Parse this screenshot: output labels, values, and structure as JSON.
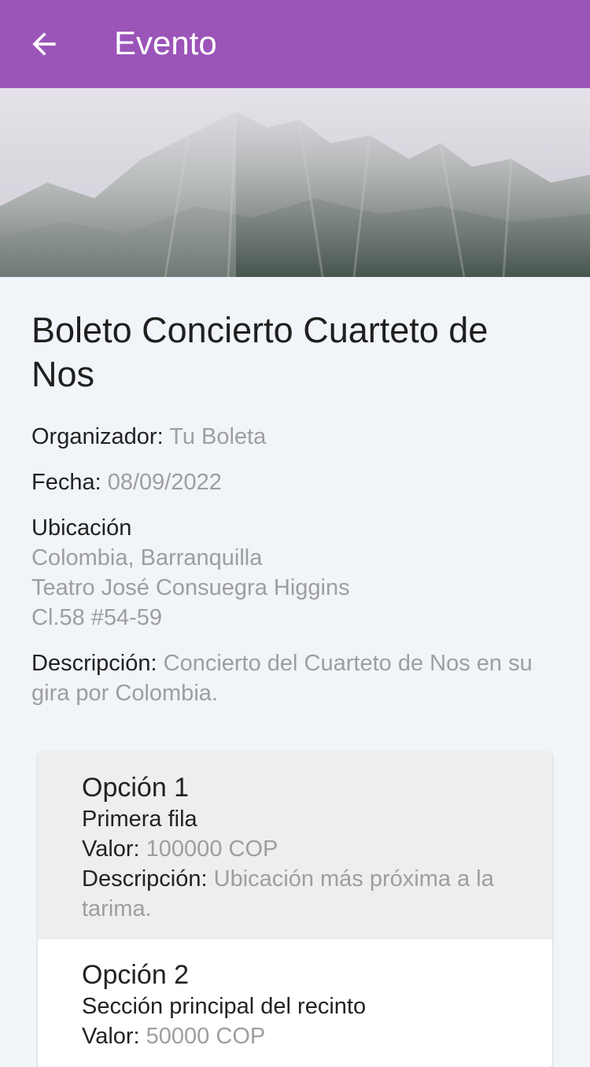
{
  "appbar": {
    "title": "Evento",
    "back_icon": "arrow-left-icon",
    "color": "#9b54b8"
  },
  "hero": {
    "image": "misty-mountains-photo"
  },
  "event": {
    "title": "Boleto Concierto Cuarteto de Nos",
    "organizer_label": "Organizador: ",
    "organizer": "Tu Boleta",
    "date_label": "Fecha: ",
    "date": "08/09/2022",
    "location_label": "Ubicación",
    "location_lines": [
      "Colombia, Barranquilla",
      "Teatro José Consuegra Higgins",
      "Cl.58 #54-59"
    ],
    "description_label": "Descripción: ",
    "description": "Concierto del Cuarteto de Nos en su gira por Colombia."
  },
  "options": [
    {
      "title": "Opción 1",
      "subtitle": "Primera fila",
      "value_label": "Valor: ",
      "value": "100000 COP",
      "description_label": "Descripción: ",
      "description": "Ubicación más próxima a la tarima."
    },
    {
      "title": "Opción 2",
      "subtitle": "Sección principal del recinto",
      "value_label": "Valor: ",
      "value": "50000 COP"
    }
  ]
}
